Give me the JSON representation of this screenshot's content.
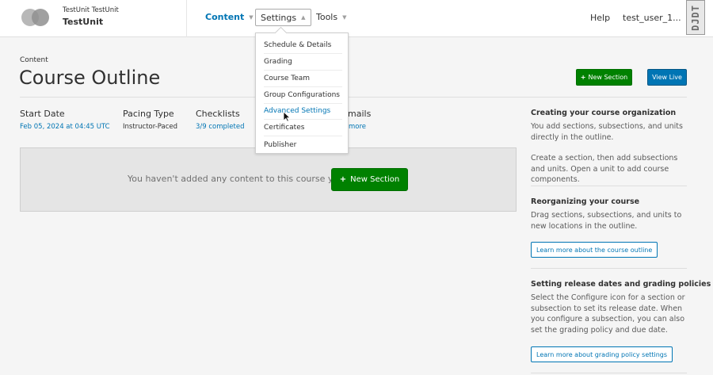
{
  "header": {
    "org_name": "TestUnit TestUnit",
    "course_name": "TestUnit",
    "nav": {
      "content": "Content",
      "settings": "Settings",
      "tools": "Tools"
    },
    "help": "Help",
    "user": "test_user_1...",
    "badge": "DJDT"
  },
  "settings_menu": {
    "items": [
      "Schedule & Details",
      "Grading",
      "Course Team",
      "Group Configurations",
      "Advanced Settings",
      "Certificates",
      "Publisher"
    ],
    "highlighted": "Advanced Settings"
  },
  "page": {
    "eyebrow": "Content",
    "title": "Course Outline",
    "new_section_top": "New Section",
    "view_live": "View Live"
  },
  "stats": {
    "start_date_label": "Start Date",
    "start_date_value": "Feb 05, 2024 at 04:45 UTC",
    "pacing_label": "Pacing Type",
    "pacing_value": "Instructor-Paced",
    "checklists_label": "Checklists",
    "checklists_value": "3/9 completed",
    "emails_label_partial": "mails",
    "emails_value_partial": "more"
  },
  "empty_state": {
    "message": "You haven't added any content to this course yet.",
    "button": "New Section"
  },
  "sidebar": {
    "s1_title": "Creating your course organization",
    "s1_p1": "You add sections, subsections, and units directly in the outline.",
    "s1_p2": "Create a section, then add subsections and units. Open a unit to add course components.",
    "s2_title": "Reorganizing your course",
    "s2_p1": "Drag sections, subsections, and units to new locations in the outline.",
    "s2_button": "Learn more about the course outline",
    "s3_title": "Setting release dates and grading policies",
    "s3_p1": "Select the Configure icon for a section or subsection to set its release date. When you configure a subsection, you can also set the grading policy and due date.",
    "s3_button": "Learn more about grading policy settings"
  },
  "colors": {
    "primary_blue": "#0075b4",
    "success_green": "#008100"
  }
}
